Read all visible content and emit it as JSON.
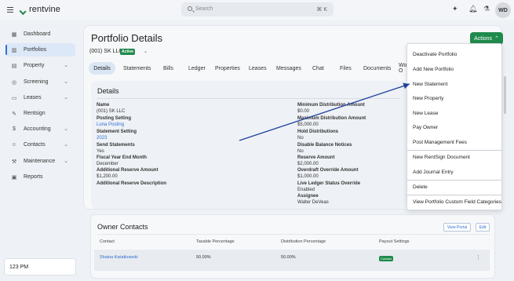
{
  "app": {
    "logo_text": "rentvine"
  },
  "topbar": {
    "search_placeholder": "Search",
    "search_shortcut": "⌘ K",
    "user_initials": "WD",
    "icons": [
      "sparkle-icon",
      "bell-icon",
      "flask-icon"
    ]
  },
  "sidebar": {
    "items": [
      {
        "label": "Dashboard",
        "icon": "dashboard-icon",
        "chevron": false
      },
      {
        "label": "Portfolios",
        "icon": "portfolio-icon",
        "chevron": false,
        "active": true
      },
      {
        "label": "Property",
        "icon": "property-icon",
        "chevron": true
      },
      {
        "label": "Screening",
        "icon": "screening-icon",
        "chevron": true
      },
      {
        "label": "Leases",
        "icon": "lease-icon",
        "chevron": true
      },
      {
        "label": "Rentsign",
        "icon": "rentsign-icon",
        "chevron": false
      },
      {
        "label": "Accounting",
        "icon": "accounting-icon",
        "chevron": true
      },
      {
        "label": "Contacts",
        "icon": "contacts-icon",
        "chevron": true
      },
      {
        "label": "Maintenance",
        "icon": "maintenance-icon",
        "chevron": true
      },
      {
        "label": "Reports",
        "icon": "reports-icon",
        "chevron": false
      }
    ],
    "clock": "123 PM"
  },
  "page": {
    "title": "Portfolio Details",
    "portfolio_name": "(001) SK LLC",
    "status_badge": "Active",
    "actions_label": "Actions",
    "tabs": [
      "Details",
      "Statements",
      "Bills",
      "Ledger",
      "Properties",
      "Leases",
      "Messages",
      "Chat",
      "Files",
      "Documents",
      "Work O"
    ]
  },
  "details": {
    "title": "Details",
    "left": [
      {
        "label": "Name",
        "value": "(001) SK LLC"
      },
      {
        "label": "Posting Setting",
        "value": "Luna Posting",
        "link": true
      },
      {
        "label": "Statement Setting",
        "value": "2023",
        "link": true
      },
      {
        "label": "Send Statements",
        "value": "Yes"
      },
      {
        "label": "Fiscal Year End Month",
        "value": "December"
      },
      {
        "label": "Additional Reserve Amount",
        "value": "$1,200.00"
      },
      {
        "label": "Additional Reserve Description",
        "value": ""
      }
    ],
    "right": [
      {
        "label": "Minimum Distribution Amount",
        "value": "$0.00"
      },
      {
        "label": "Maximum Distribution Amount",
        "value": "$5,000.00"
      },
      {
        "label": "Hold Distributions",
        "value": "No"
      },
      {
        "label": "Disable Balance Notices",
        "value": "No"
      },
      {
        "label": "Reserve Amount",
        "value": "$2,000.00"
      },
      {
        "label": "Overdraft Override Amount",
        "value": "$1,000.00"
      },
      {
        "label": "Live Ledger Status Override",
        "value": "Enabled"
      },
      {
        "label": "Assignee",
        "value": "Walter DeVeas"
      }
    ]
  },
  "owner_contacts": {
    "title": "Owner Contacts",
    "view_portal_label": "View Portal",
    "edit_label": "Edit",
    "columns": [
      "Contact",
      "Taxable Percentage",
      "Distribution Percentage",
      "Payout Settings"
    ],
    "rows": [
      {
        "contact": "Shaina Kwiatkowski",
        "taxable": "50.00%",
        "distribution": "50.00%",
        "payout": "Contact"
      }
    ]
  },
  "actions_menu": {
    "items": [
      "Deactivate Portfolio",
      "Add New Portfolio",
      "New Statement",
      "New Property",
      "New Lease",
      "Pay Owner",
      "Post Management Fees",
      "New RentSign Document",
      "Add Journal Entry",
      "Delete",
      "View Portfolio Custom Field Categories"
    ]
  },
  "colors": {
    "brand_green": "#1f8a4c",
    "link_blue": "#2f6fd4",
    "annotation_arrow": "#1f3f9e"
  }
}
